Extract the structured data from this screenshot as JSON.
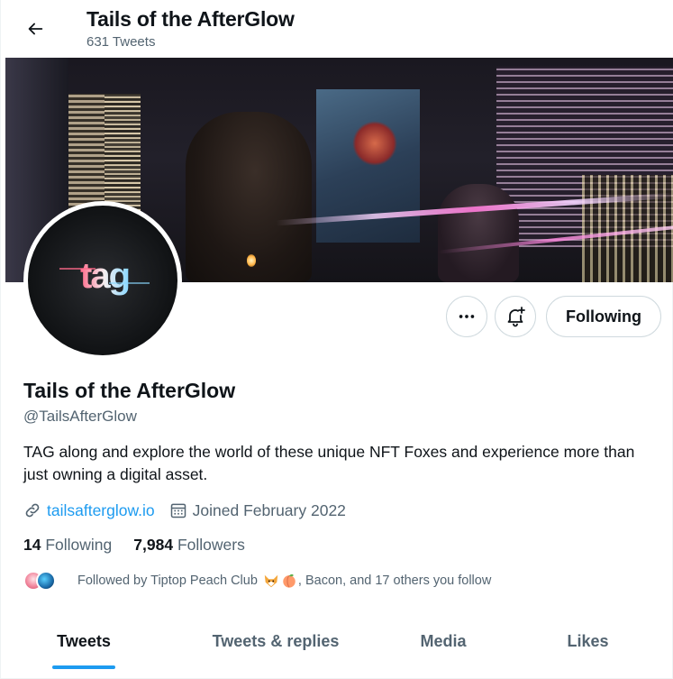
{
  "header": {
    "title": "Tails of the AfterGlow",
    "tweet_count": "631 Tweets",
    "back_icon": "arrow-left-icon"
  },
  "actions": {
    "more_icon": "more-horizontal-icon",
    "notify_icon": "bell-plus-icon",
    "following_label": "Following"
  },
  "profile": {
    "display_name": "Tails of the AfterGlow",
    "handle": "@TailsAfterGlow",
    "bio": "TAG along and explore the world of these unique NFT Foxes and experience more than just owning a digital asset.",
    "website": "tailsafterglow.io",
    "joined": "Joined February 2022",
    "avatar_text": "tag"
  },
  "stats": {
    "following_count": "14",
    "following_label": "Following",
    "followers_count": "7,984",
    "followers_label": "Followers"
  },
  "followed_by": {
    "prefix": "Followed by Tiptop Peach Club",
    "suffix": ", Bacon, and 17 others you follow"
  },
  "tabs": [
    {
      "label": "Tweets",
      "active": true
    },
    {
      "label": "Tweets & replies",
      "active": false
    },
    {
      "label": "Media",
      "active": false
    },
    {
      "label": "Likes",
      "active": false
    }
  ],
  "colors": {
    "accent": "#1d9bf0",
    "text": "#0f1419",
    "muted": "#536471"
  }
}
